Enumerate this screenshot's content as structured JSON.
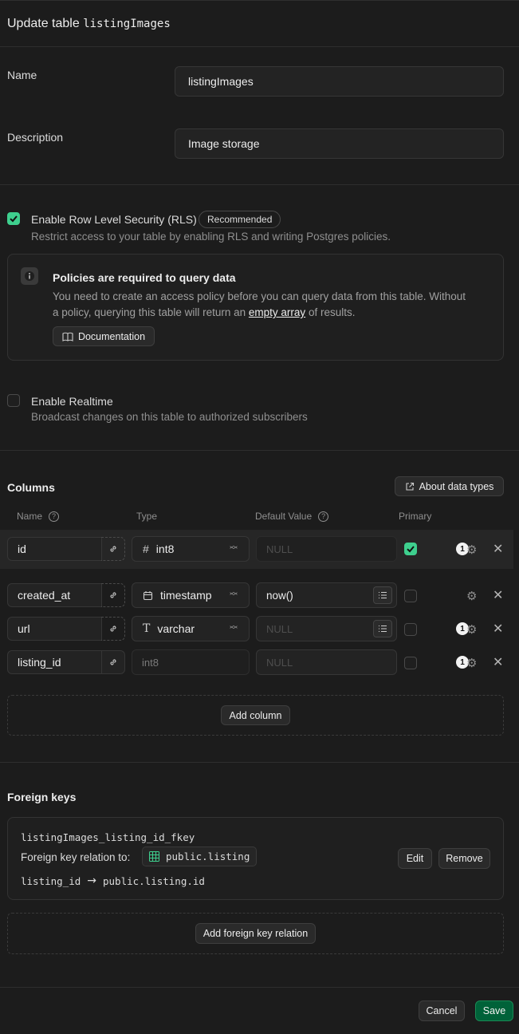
{
  "header": {
    "title_prefix": "Update table",
    "table_name": "listingImages"
  },
  "name_field": {
    "label": "Name",
    "value": "listingImages"
  },
  "description_field": {
    "label": "Description",
    "value": "Image storage"
  },
  "rls": {
    "label": "Enable Row Level Security (RLS)",
    "badge": "Recommended",
    "description": "Restrict access to your table by enabling RLS and writing Postgres policies.",
    "checked": true
  },
  "policy_notice": {
    "title": "Policies are required to query data",
    "line1": "You need to create an access policy before you can query data from this table. Without",
    "line2_prefix": "a policy, querying this table will return an",
    "line2_link": "empty array",
    "line2_suffix": "of results.",
    "doc_button": "Documentation"
  },
  "realtime": {
    "label": "Enable Realtime",
    "description": "Broadcast changes on this table to authorized subscribers",
    "checked": false
  },
  "columns": {
    "title": "Columns",
    "about_button": "About data types",
    "headers": {
      "name": "Name",
      "type": "Type",
      "default": "Default Value",
      "primary": "Primary"
    },
    "rows": [
      {
        "name": "id",
        "type_icon": "#",
        "type": "int8",
        "default": "NULL",
        "primary": true,
        "badge": "1"
      },
      {
        "name": "created_at",
        "type_icon": "calendar",
        "type": "timestamp",
        "default": "now()",
        "primary": false,
        "badge": ""
      },
      {
        "name": "url",
        "type_icon": "T",
        "type": "varchar",
        "default": "NULL",
        "primary": false,
        "badge": "1"
      },
      {
        "name": "listing_id",
        "type_icon": "",
        "type": "int8",
        "default": "NULL",
        "primary": false,
        "badge": "1"
      }
    ],
    "add_button": "Add column"
  },
  "foreign_keys": {
    "title": "Foreign keys",
    "fkey_name": "listingImages_listing_id_fkey",
    "relation_label": "Foreign key relation to:",
    "relation_target": "public.listing",
    "mapping_from": "listing_id",
    "mapping_to": "public.listing.id",
    "edit_button": "Edit",
    "remove_button": "Remove",
    "add_button": "Add foreign key relation"
  },
  "footer": {
    "cancel": "Cancel",
    "save": "Save"
  },
  "colors": {
    "accent": "#3ecf8e",
    "save_bg": "#006239",
    "background": "#1c1c1c"
  }
}
